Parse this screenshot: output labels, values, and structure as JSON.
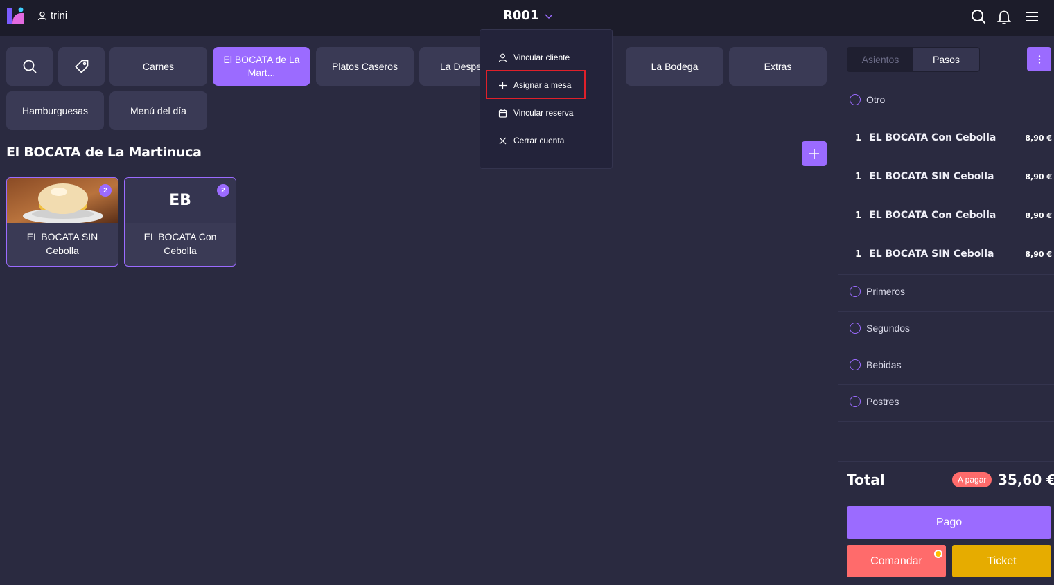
{
  "header": {
    "user": "trini",
    "order": "R001"
  },
  "categories": [
    {
      "label": "Carnes"
    },
    {
      "label": "El BOCATA de La Mart..."
    },
    {
      "label": "Platos Caseros"
    },
    {
      "label": "La Despe"
    },
    {
      "label": "La Bodega"
    },
    {
      "label": "Extras"
    },
    {
      "label": "Hamburguesas"
    },
    {
      "label": "Menú del día"
    }
  ],
  "section": {
    "title": "El BOCATA de La Martinuca"
  },
  "products": [
    {
      "name": "EL BOCATA SIN Cebolla",
      "count": "2"
    },
    {
      "name": "EL BOCATA Con Cebolla",
      "initials": "EB",
      "count": "2"
    }
  ],
  "dropdown": {
    "items": [
      {
        "label": "Vincular cliente"
      },
      {
        "label": "Asignar a mesa"
      },
      {
        "label": "Vincular reserva"
      },
      {
        "label": "Cerrar cuenta"
      }
    ]
  },
  "panel": {
    "tabs": [
      "Asientos",
      "Pasos"
    ],
    "steps": {
      "otro": "Otro",
      "primeros": "Primeros",
      "segundos": "Segundos",
      "bebidas": "Bebidas",
      "postres": "Postres"
    },
    "lines": [
      {
        "qty": "1",
        "name": "EL BOCATA Con Cebolla",
        "price": "8,90 €"
      },
      {
        "qty": "1",
        "name": "EL BOCATA SIN Cebolla",
        "price": "8,90 €"
      },
      {
        "qty": "1",
        "name": "EL BOCATA Con Cebolla",
        "price": "8,90 €"
      },
      {
        "qty": "1",
        "name": "EL BOCATA SIN Cebolla",
        "price": "8,90 €"
      }
    ],
    "total_label": "Total",
    "status": "A pagar",
    "total": "35,60 €",
    "pay": "Pago",
    "send": "Comandar",
    "ticket": "Ticket"
  },
  "colors": {
    "accent": "#9b6bff",
    "coral": "#ff6b6b",
    "gold": "#e6ac00",
    "highlight": "#e0202a"
  }
}
